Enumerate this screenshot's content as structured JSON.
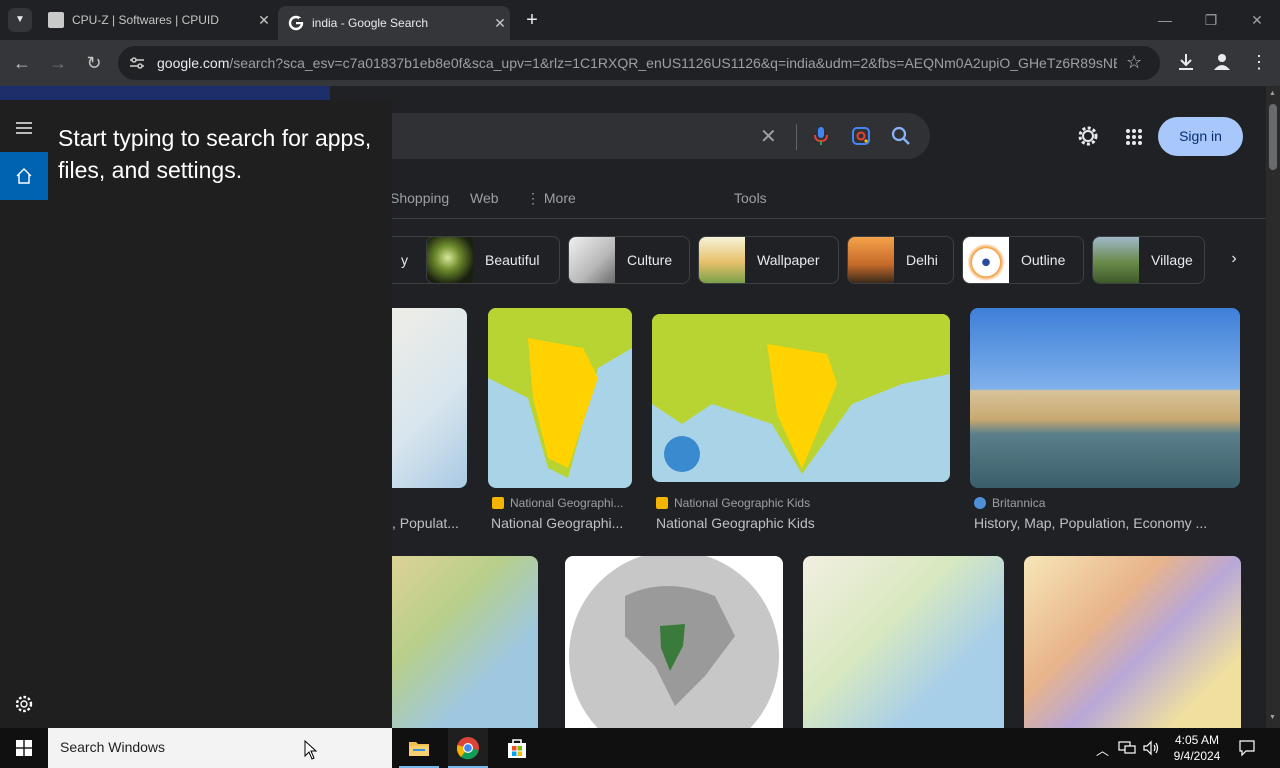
{
  "browser": {
    "tabs": [
      {
        "title": "CPU-Z | Softwares | CPUID"
      },
      {
        "title": "india - Google Search"
      }
    ],
    "url_host": "google.com",
    "url_path": "/search?sca_esv=c7a01837b1eb8e0f&sca_upv=1&rlz=1C1RXQR_enUS1126US1126&q=india&udm=2&fbs=AEQNm0A2upiO_GHeTz6R89sNEj..."
  },
  "search": {
    "sign_in": "Sign in",
    "nav": [
      "Shopping",
      "Web",
      "More",
      "Tools"
    ],
    "chips": [
      {
        "label": "Beautiful"
      },
      {
        "label": "Culture"
      },
      {
        "label": "Wallpaper"
      },
      {
        "label": "Delhi"
      },
      {
        "label": "Outline"
      },
      {
        "label": "Village"
      }
    ],
    "chip_partial": "y",
    "results_row1": [
      {
        "source": "",
        "caption": ", Populat..."
      },
      {
        "source": "National Geographi...",
        "caption": "National Geographi..."
      },
      {
        "source": "National Geographic Kids",
        "caption": "National Geographic Kids"
      },
      {
        "source": "Britannica",
        "caption": "History, Map, Population, Economy ..."
      }
    ]
  },
  "start_search": {
    "prompt": "Start typing to search for apps, files, and settings."
  },
  "taskbar": {
    "search_placeholder": "Search Windows",
    "time": "4:05 AM",
    "date": "9/4/2024"
  },
  "colors": {
    "accent": "#8ab4f8",
    "signin_bg": "#a8c7fa",
    "start_selected": "#0063b1"
  }
}
